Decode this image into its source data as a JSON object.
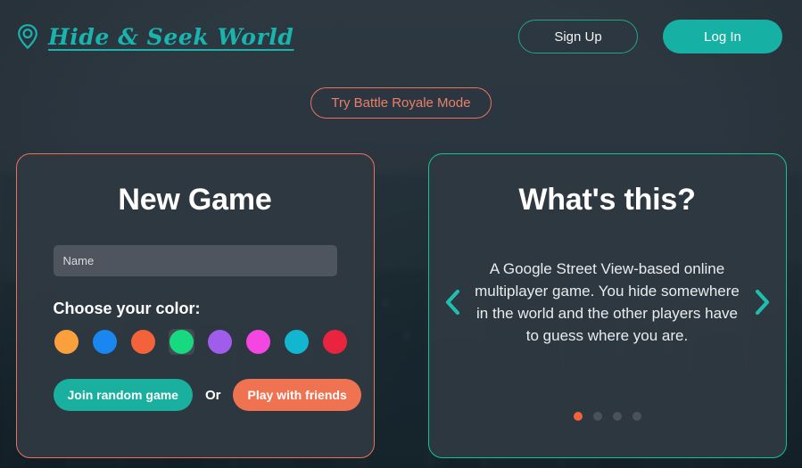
{
  "theme": {
    "teal": "#17b0a4",
    "coral": "#e8735a",
    "background": "#2b3640",
    "card_background": "#2f3942",
    "text": "#ffffff"
  },
  "header": {
    "brand_name": "Hide & Seek World",
    "brand_icon": "map-pin-icon",
    "sign_up_label": "Sign Up",
    "log_in_label": "Log In"
  },
  "promo": {
    "battle_royale_label": "Try Battle Royale Mode"
  },
  "new_game": {
    "title": "New Game",
    "name_placeholder": "Name",
    "name_value": "",
    "choose_color_label": "Choose your color:",
    "colors": [
      {
        "name": "orange",
        "hex": "#fca03e",
        "selected": false
      },
      {
        "name": "blue",
        "hex": "#1a86f0",
        "selected": false
      },
      {
        "name": "orange-red",
        "hex": "#f4623a",
        "selected": false
      },
      {
        "name": "green",
        "hex": "#17d97f",
        "selected": true
      },
      {
        "name": "purple",
        "hex": "#a05ceb",
        "selected": false
      },
      {
        "name": "magenta",
        "hex": "#f446e0",
        "selected": false
      },
      {
        "name": "cyan",
        "hex": "#13b6cf",
        "selected": false
      },
      {
        "name": "red",
        "hex": "#e8243f",
        "selected": false
      }
    ],
    "join_random_label": "Join random game",
    "or_label": "Or",
    "play_friends_label": "Play with friends"
  },
  "info_carousel": {
    "title": "What's this?",
    "body": "A Google Street View-based online multiplayer game. You hide somewhere in the world and the other players have to guess where you are.",
    "prev_icon": "chevron-left-icon",
    "next_icon": "chevron-right-icon",
    "slide_count": 4,
    "active_slide": 1
  }
}
